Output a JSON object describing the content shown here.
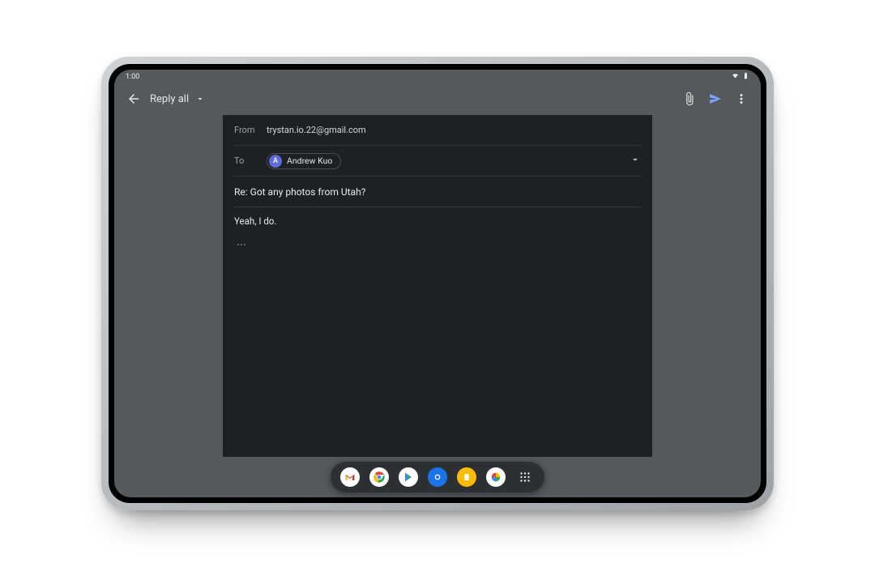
{
  "statusbar": {
    "time": "1:00"
  },
  "appbar": {
    "title": "Reply all"
  },
  "compose": {
    "from_label": "From",
    "from_value": "trystan.io.22@gmail.com",
    "to_label": "To",
    "to_chip_initial": "A",
    "to_chip_name": "Andrew Kuo",
    "subject": "Re: Got any photos from Utah?",
    "body": "Yeah, I do."
  },
  "taskbar": {
    "icons": [
      "gmail",
      "chrome",
      "play-store",
      "camera",
      "keep",
      "photos",
      "app-drawer"
    ]
  }
}
